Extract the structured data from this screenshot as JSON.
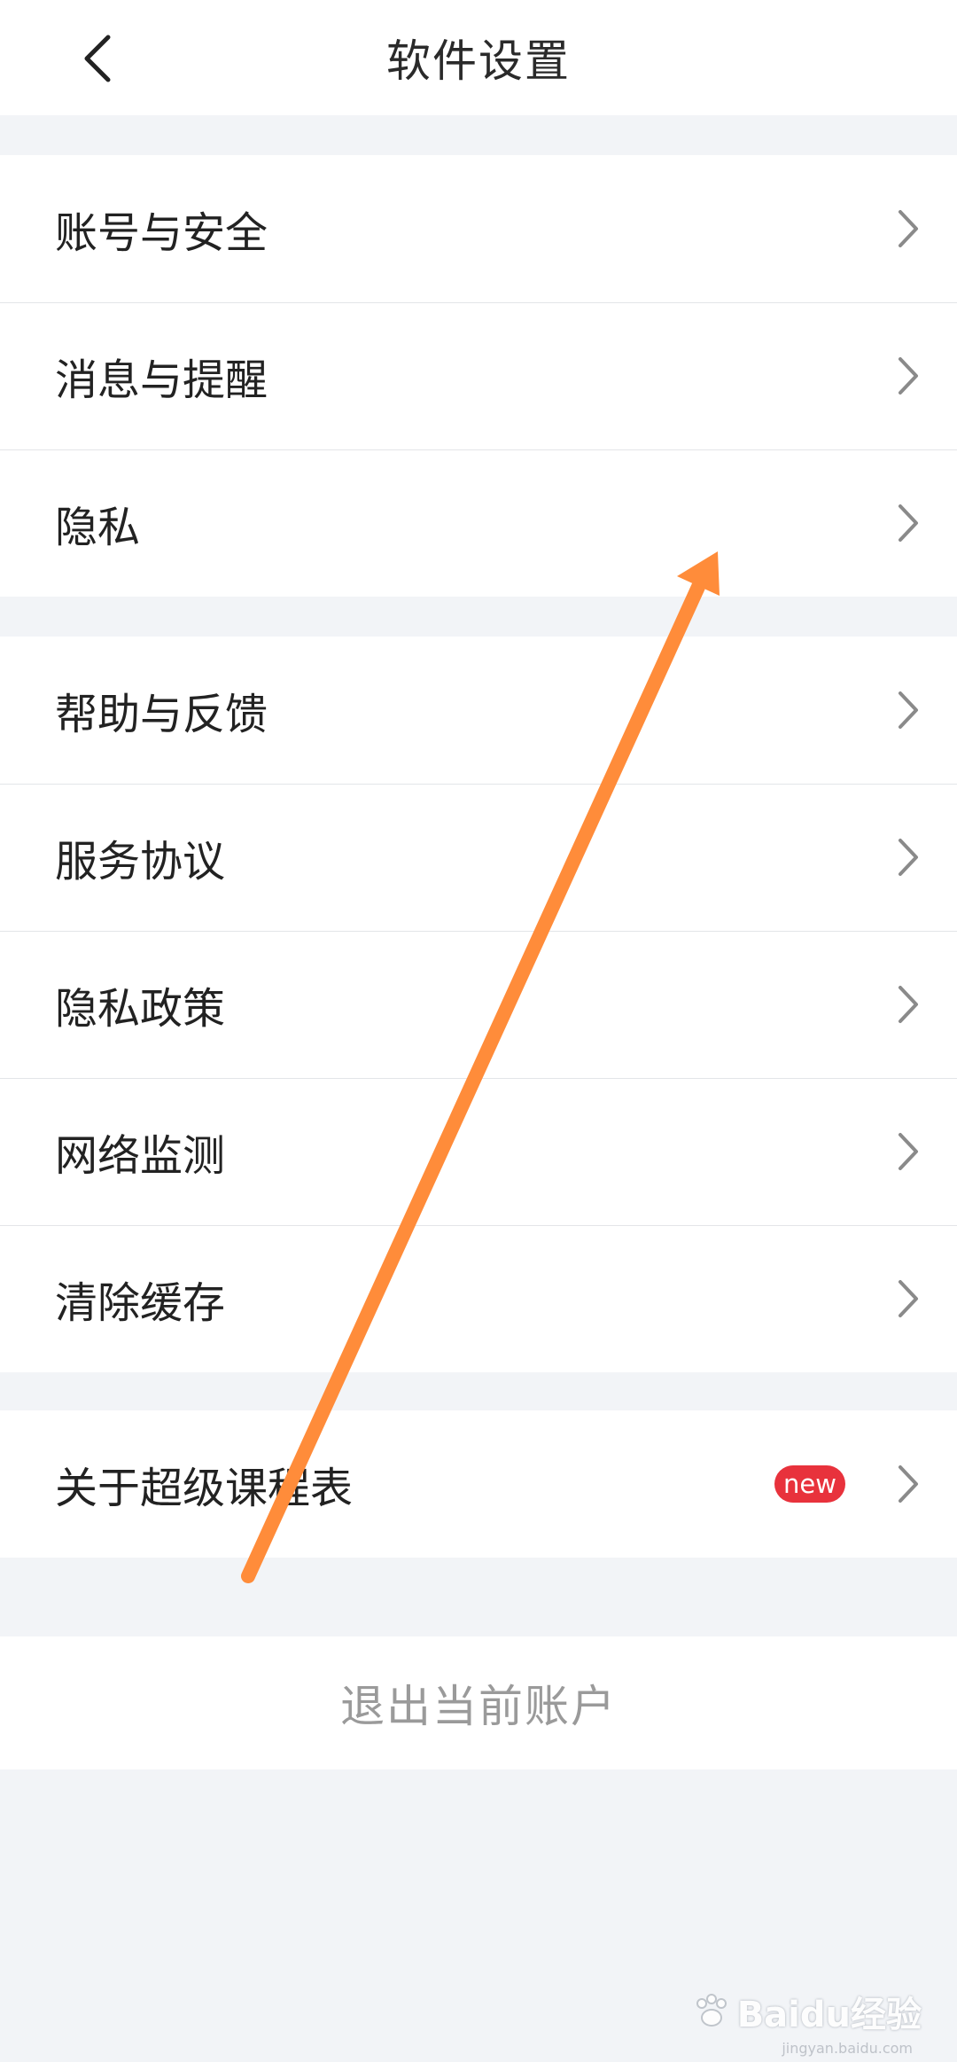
{
  "header": {
    "title": "软件设置",
    "back_icon": "chevron-left-icon"
  },
  "groups": [
    {
      "items": [
        {
          "label": "账号与安全"
        },
        {
          "label": "消息与提醒"
        },
        {
          "label": "隐私"
        }
      ]
    },
    {
      "items": [
        {
          "label": "帮助与反馈"
        },
        {
          "label": "服务协议"
        },
        {
          "label": "隐私政策"
        },
        {
          "label": "网络监测"
        },
        {
          "label": "清除缓存"
        }
      ]
    },
    {
      "items": [
        {
          "label": "关于超级课程表",
          "badge": "new"
        }
      ]
    }
  ],
  "logout": {
    "label": "退出当前账户"
  },
  "annotation": {
    "color": "#ff8c3a"
  },
  "watermark": {
    "brand": "Baidu经验",
    "sub": "jingyan.baidu.com"
  },
  "colors": {
    "background": "#f2f4f7",
    "badge": "#e8323c",
    "logout_text": "#9a9a9a"
  }
}
